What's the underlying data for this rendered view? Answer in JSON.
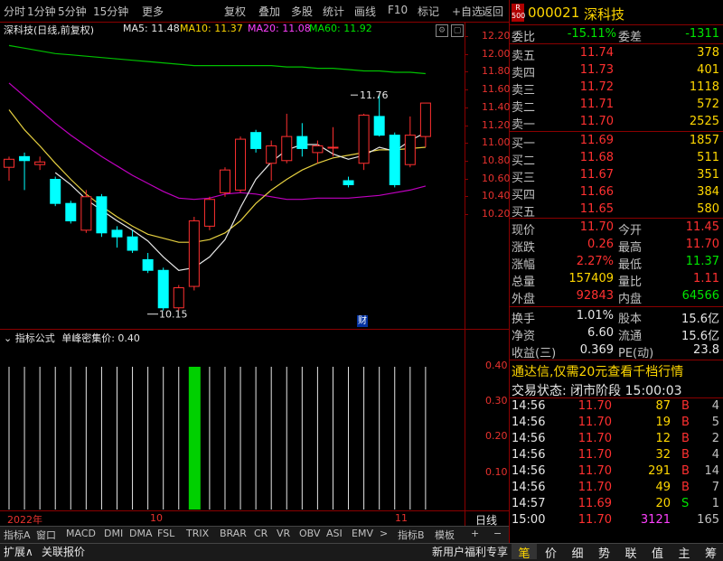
{
  "toolbar": {
    "items": [
      "分时",
      "1分钟",
      "5分钟",
      "15分钟",
      "更多",
      "复权",
      "叠加",
      "多股",
      "统计",
      "画线",
      "F10",
      "标记",
      "+自选",
      "返回"
    ]
  },
  "chart": {
    "title": "深科技(日线,前复权)",
    "ma5": "MA5: 11.48",
    "ma10": "MA10: 11.37",
    "ma20": "MA20: 11.08",
    "ma60": "MA60: 11.92",
    "high_label": "11.76",
    "low_label": "10.15",
    "cai_label": "财",
    "yticks": [
      "12.20",
      "12.00",
      "11.80",
      "11.60",
      "11.40",
      "11.20",
      "11.00",
      "10.80",
      "10.60",
      "10.40",
      "10.20"
    ]
  },
  "indicator": {
    "title": "指标公式",
    "name": "单峰密集价: 0.40",
    "yticks": [
      "0.40",
      "0.30",
      "0.20",
      "0.10"
    ]
  },
  "xaxis": {
    "labels": [
      "2022年",
      "10",
      "11"
    ],
    "period": "日线"
  },
  "tabs": [
    "指标A",
    "窗口",
    "MACD",
    "DMI",
    "DMA",
    "FSL",
    "TRIX",
    "BRAR",
    "CR",
    "VR",
    "OBV",
    "ASI",
    "EMV",
    ">",
    "指标B",
    "模板",
    "+",
    "−"
  ],
  "tabs_bottom": {
    "left": [
      "扩展∧",
      "关联报价"
    ],
    "right": "新用户福利专享"
  },
  "right_panel": {
    "badge_top": "R",
    "badge_bottom": "500",
    "code": "000021",
    "name": "深科技",
    "weibi_label": "委比",
    "weibi": "-15.11%",
    "weicha_label": "委差",
    "weicha": "-1311",
    "sells": [
      {
        "label": "卖五",
        "price": "11.74",
        "vol": "378"
      },
      {
        "label": "卖四",
        "price": "11.73",
        "vol": "401"
      },
      {
        "label": "卖三",
        "price": "11.72",
        "vol": "1118"
      },
      {
        "label": "卖二",
        "price": "11.71",
        "vol": "572"
      },
      {
        "label": "卖一",
        "price": "11.70",
        "vol": "2525"
      }
    ],
    "buys": [
      {
        "label": "买一",
        "price": "11.69",
        "vol": "1857"
      },
      {
        "label": "买二",
        "price": "11.68",
        "vol": "511"
      },
      {
        "label": "买三",
        "price": "11.67",
        "vol": "351"
      },
      {
        "label": "买四",
        "price": "11.66",
        "vol": "384"
      },
      {
        "label": "买五",
        "price": "11.65",
        "vol": "580"
      }
    ],
    "stats": [
      {
        "l1": "现价",
        "v1": "11.70",
        "l2": "今开",
        "v2": "11.45"
      },
      {
        "l1": "涨跌",
        "v1": "0.26",
        "l2": "最高",
        "v2": "11.70"
      },
      {
        "l1": "涨幅",
        "v1": "2.27%",
        "l2": "最低",
        "v2": "11.37"
      },
      {
        "l1": "总量",
        "v1": "157409",
        "l2": "量比",
        "v2": "1.11"
      },
      {
        "l1": "外盘",
        "v1": "92843",
        "l2": "内盘",
        "v2": "64566"
      }
    ],
    "stats2": [
      {
        "l1": "换手",
        "v1": "1.01%",
        "l2": "股本",
        "v2": "15.6亿"
      },
      {
        "l1": "净资",
        "v1": "6.60",
        "l2": "流通",
        "v2": "15.6亿"
      },
      {
        "l1": "收益(三)",
        "v1": "0.369",
        "l2": "PE(动)",
        "v2": "23.8"
      }
    ],
    "promo": "通达信,仅需20元查看千档行情",
    "status_label": "交易状态: 闭市阶段",
    "status_time": "15:00:03",
    "ticks": [
      {
        "t": "14:56",
        "p": "11.70",
        "v": "87",
        "bs": "B",
        "n": "4"
      },
      {
        "t": "14:56",
        "p": "11.70",
        "v": "19",
        "bs": "B",
        "n": "5"
      },
      {
        "t": "14:56",
        "p": "11.70",
        "v": "12",
        "bs": "B",
        "n": "2"
      },
      {
        "t": "14:56",
        "p": "11.70",
        "v": "32",
        "bs": "B",
        "n": "4"
      },
      {
        "t": "14:56",
        "p": "11.70",
        "v": "291",
        "bs": "B",
        "n": "14"
      },
      {
        "t": "14:56",
        "p": "11.70",
        "v": "49",
        "bs": "B",
        "n": "7"
      },
      {
        "t": "14:57",
        "p": "11.69",
        "v": "20",
        "bs": "S",
        "n": "1"
      },
      {
        "t": "15:00",
        "p": "11.70",
        "v": "3121",
        "bs": "",
        "n": "165"
      }
    ],
    "bottom_tabs": [
      "笔",
      "价",
      "细",
      "势",
      "联",
      "值",
      "主",
      "筹"
    ]
  },
  "candles": [
    {
      "o": 11.22,
      "c": 11.28,
      "h": 11.3,
      "l": 11.12
    },
    {
      "o": 11.3,
      "c": 11.27,
      "h": 11.33,
      "l": 11.05
    },
    {
      "o": 11.24,
      "c": 11.26,
      "h": 11.3,
      "l": 11.2
    },
    {
      "o": 11.13,
      "c": 10.95,
      "h": 11.15,
      "l": 10.93
    },
    {
      "o": 10.95,
      "c": 10.82,
      "h": 10.97,
      "l": 10.8
    },
    {
      "o": 10.75,
      "c": 11.0,
      "h": 11.05,
      "l": 10.73
    },
    {
      "o": 11.0,
      "c": 10.73,
      "h": 11.02,
      "l": 10.7
    },
    {
      "o": 10.75,
      "c": 10.7,
      "h": 10.78,
      "l": 10.62
    },
    {
      "o": 10.7,
      "c": 10.6,
      "h": 10.75,
      "l": 10.58
    },
    {
      "o": 10.53,
      "c": 10.45,
      "h": 10.58,
      "l": 10.43
    },
    {
      "o": 10.45,
      "c": 10.17,
      "h": 10.47,
      "l": 10.15
    },
    {
      "o": 10.17,
      "c": 10.32,
      "h": 10.34,
      "l": 10.15
    },
    {
      "o": 10.33,
      "c": 10.82,
      "h": 10.85,
      "l": 10.3
    },
    {
      "o": 10.78,
      "c": 10.98,
      "h": 11.0,
      "l": 10.75
    },
    {
      "o": 11.03,
      "c": 11.2,
      "h": 11.22,
      "l": 11.0
    },
    {
      "o": 11.05,
      "c": 11.43,
      "h": 11.45,
      "l": 11.03
    },
    {
      "o": 11.48,
      "c": 11.36,
      "h": 11.5,
      "l": 11.33
    },
    {
      "o": 11.25,
      "c": 11.38,
      "h": 11.42,
      "l": 11.12
    },
    {
      "o": 11.27,
      "c": 11.45,
      "h": 11.62,
      "l": 11.25
    },
    {
      "o": 11.45,
      "c": 11.36,
      "h": 11.55,
      "l": 11.3
    },
    {
      "o": 11.33,
      "c": 11.38,
      "h": 11.42,
      "l": 11.25
    },
    {
      "o": 11.37,
      "c": 11.37,
      "h": 11.52,
      "l": 11.3
    },
    {
      "o": 11.12,
      "c": 11.09,
      "h": 11.15,
      "l": 11.07
    },
    {
      "o": 11.25,
      "c": 11.61,
      "h": 11.62,
      "l": 11.2
    },
    {
      "o": 11.6,
      "c": 11.46,
      "h": 11.76,
      "l": 11.45
    },
    {
      "o": 11.46,
      "c": 11.09,
      "h": 11.48,
      "l": 11.07
    },
    {
      "o": 11.24,
      "c": 11.46,
      "h": 11.6,
      "l": 11.22
    },
    {
      "o": 11.45,
      "c": 11.7,
      "h": 11.7,
      "l": 11.37
    }
  ],
  "ma_lines": {
    "ma60": [
      12.13,
      12.11,
      12.09,
      12.07,
      12.06,
      12.05,
      12.04,
      12.03,
      12.02,
      12.01,
      12.0,
      11.99,
      11.98,
      11.98,
      11.98,
      11.98,
      11.98,
      11.98,
      11.97,
      11.97,
      11.96,
      11.96,
      11.95,
      11.94,
      11.94,
      11.93,
      11.93,
      11.92
    ],
    "ma20": [
      11.85,
      11.75,
      11.65,
      11.55,
      11.46,
      11.38,
      11.3,
      11.23,
      11.16,
      11.1,
      11.04,
      10.99,
      10.98,
      10.99,
      11.02,
      11.03,
      11.02,
      11.0,
      10.98,
      10.98,
      10.99,
      10.99,
      10.99,
      11.0,
      11.01,
      11.03,
      11.05,
      11.08
    ],
    "ma10": [
      11.65,
      11.5,
      11.38,
      11.25,
      11.13,
      11.02,
      10.93,
      10.85,
      10.78,
      10.72,
      10.69,
      10.66,
      10.66,
      10.68,
      10.73,
      10.82,
      10.95,
      11.05,
      11.13,
      11.2,
      11.25,
      11.29,
      11.31,
      11.33,
      11.35,
      11.35,
      11.36,
      11.37
    ],
    "ma5": [
      null,
      null,
      null,
      11.18,
      11.09,
      10.98,
      10.9,
      10.82,
      10.75,
      10.67,
      10.55,
      10.45,
      10.47,
      10.55,
      10.68,
      10.92,
      11.13,
      11.26,
      11.35,
      11.39,
      11.39,
      11.32,
      11.28,
      11.31,
      11.37,
      11.34,
      11.42,
      11.48
    ]
  },
  "volume_bar_values": [
    0.4,
    0.4,
    0.4,
    0.4,
    0.4,
    0.4,
    0.4,
    0.4,
    0.4,
    0.4,
    0.4,
    0.4,
    0.4,
    0.4,
    0.4,
    0.4,
    0.4,
    0.4,
    0.4,
    0.4,
    0.4,
    0.4,
    0.4,
    0.4,
    0.4,
    0.4,
    0.4,
    0.4
  ]
}
